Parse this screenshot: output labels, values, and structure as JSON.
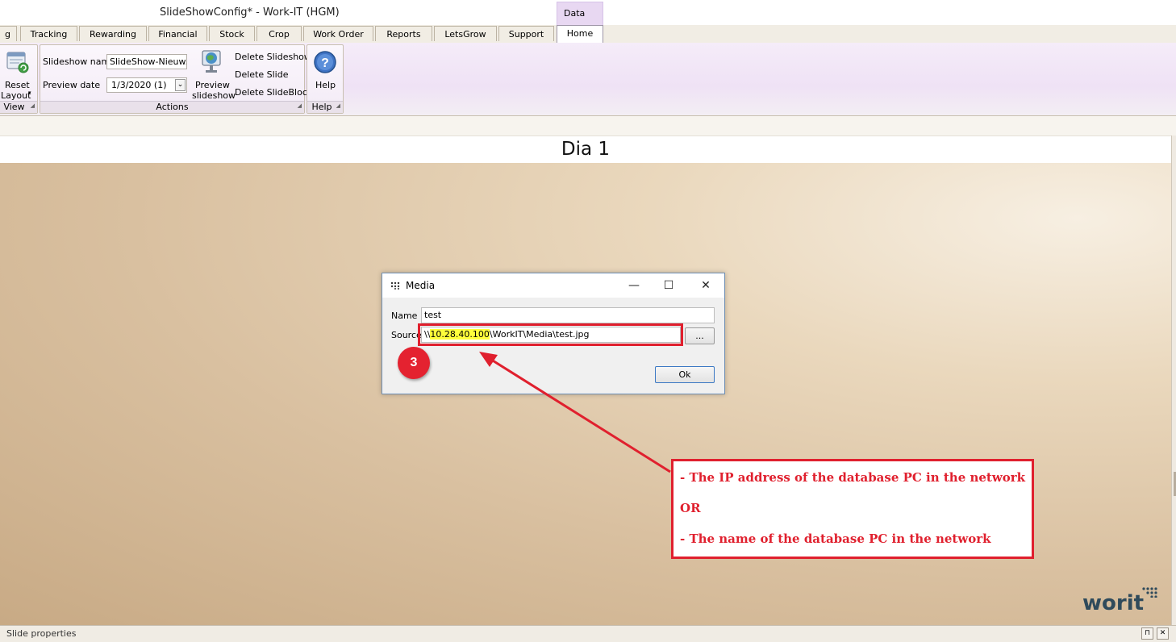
{
  "window": {
    "title": "SlideShowConfig* - Work-IT (HGM)"
  },
  "context_tab": {
    "label": "Data"
  },
  "tabs": [
    {
      "label": "g"
    },
    {
      "label": "Tracking"
    },
    {
      "label": "Rewarding"
    },
    {
      "label": "Financial"
    },
    {
      "label": "Stock"
    },
    {
      "label": "Crop"
    },
    {
      "label": "Work Order"
    },
    {
      "label": "Reports"
    },
    {
      "label": "LetsGrow"
    },
    {
      "label": "Support"
    },
    {
      "label": "Home",
      "active": true
    }
  ],
  "ribbon": {
    "view": {
      "reset_label": "Reset",
      "layout_label": "Layout",
      "group_label": "View"
    },
    "actions": {
      "slideshow_name_label": "Slideshow name",
      "slideshow_name_value": "SlideShow-Nieuw...",
      "preview_date_label": "Preview date",
      "preview_date_value": "1/3/2020 (1)",
      "preview_label_1": "Preview",
      "preview_label_2": "slideshow",
      "delete_slideshow": "Delete Slideshow",
      "delete_slide": "Delete Slide",
      "delete_slideblock": "Delete SlideBlock",
      "group_label": "Actions"
    },
    "help": {
      "help_label": "Help",
      "group_label": "Help"
    }
  },
  "slide": {
    "title": "Dia 1"
  },
  "dialog": {
    "title": "Media",
    "name_label": "Name",
    "name_value": "test",
    "source_label": "Source",
    "source_prefix": "\\\\",
    "source_ip": "10.28.40.100",
    "source_suffix": "\\WorkIT\\Media\\test.jpg",
    "browse_label": "...",
    "ok_label": "Ok"
  },
  "annotation": {
    "badge": "3",
    "line1": "- The IP address of the database PC in the network",
    "line2": "OR",
    "line3": "- The name of the database PC in the network",
    "color": "#e0202e"
  },
  "logo": {
    "prefix": "wor",
    "k": "k",
    "suffix": "it"
  },
  "status": {
    "label": "Slide properties"
  }
}
